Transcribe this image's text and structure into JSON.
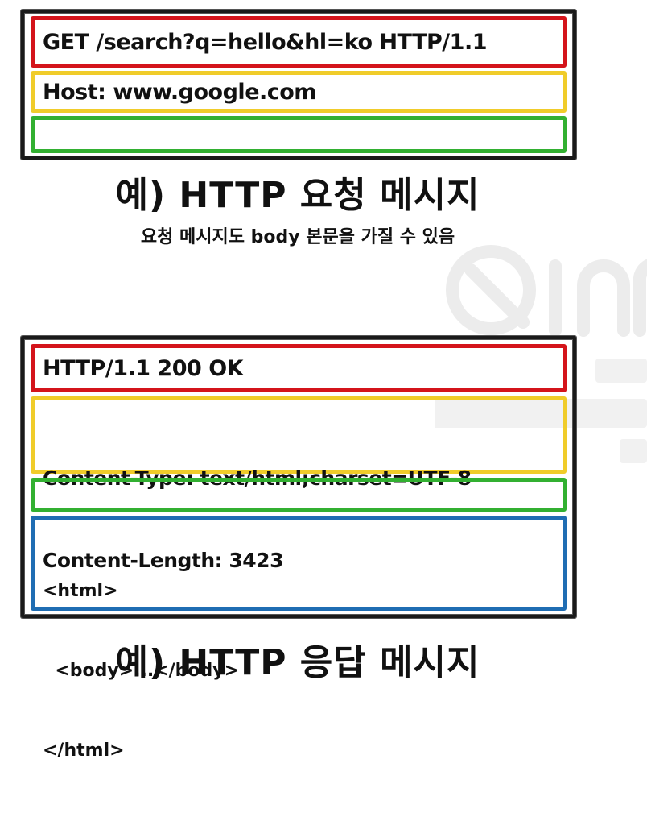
{
  "request": {
    "start_line": "GET /search?q=hello&hl=ko HTTP/1.1",
    "header": "Host: www.google.com",
    "blank": "",
    "caption": "예) HTTP 요청 메시지",
    "note": "요청 메시지도 body 본문을 가질 수 있음"
  },
  "response": {
    "status_line": "HTTP/1.1 200 OK",
    "headers": [
      "Content-Type: text/html;charset=UTF-8",
      "Content-Length: 3423"
    ],
    "blank": "",
    "body_lines": [
      "<html>",
      "  <body>...</body>",
      "</html>"
    ],
    "caption": "예) HTTP 응답 메시지"
  },
  "colors": {
    "start_line": "#d4141b",
    "header": "#f0cc2a",
    "blank_line": "#32b031",
    "body": "#1f6db3"
  }
}
